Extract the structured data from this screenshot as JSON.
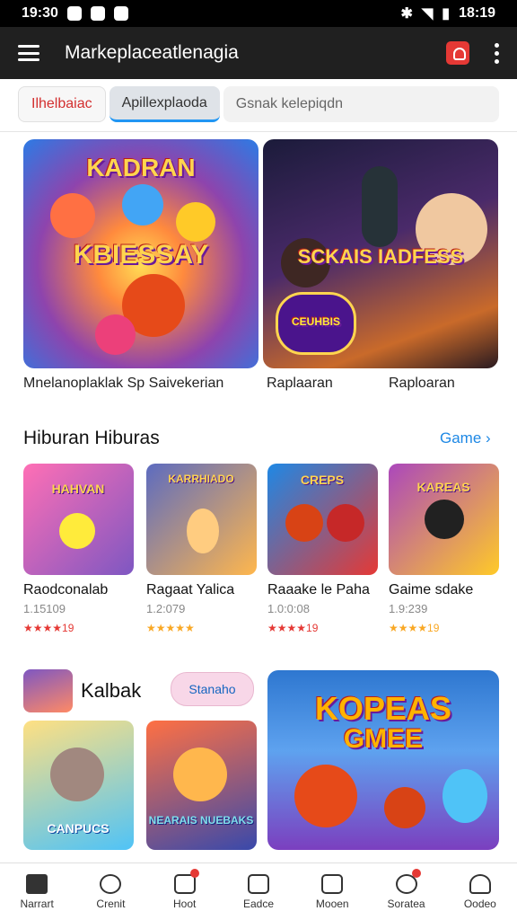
{
  "status_bar": {
    "time": "19:30",
    "right_text": "18:19"
  },
  "app_bar": {
    "title": "Markeplaceatlenagia"
  },
  "tabs": [
    {
      "label": "Ilhelbaiac"
    },
    {
      "label": "Apillexplaoda"
    },
    {
      "label": "Gsnak kelepiqdn"
    }
  ],
  "hero": {
    "left": {
      "title": "KADRAN",
      "subtitle": "KBIESSAY",
      "caption": "Mnelanoplaklak Sp Saivekerian"
    },
    "right": {
      "title": "SCKAIS IADFESS",
      "badge_text": "CEUHBIS",
      "caption_1": "Raplaaran",
      "caption_2": "Raploaran"
    }
  },
  "section": {
    "title": "Hiburan Hiburas",
    "link": "Game"
  },
  "apps": [
    {
      "name": "Raodconalab",
      "size": "1.15109",
      "rating": "★★★★19",
      "art_text": "HAHVAN",
      "colors": [
        "#ff6fb5",
        "#7e57c2"
      ]
    },
    {
      "name": "Ragaat Yalica",
      "size": "1.2:079",
      "rating": "★★★★★",
      "art_text": "KARRHIADO",
      "colors": [
        "#5c6bc0",
        "#ffb74d"
      ]
    },
    {
      "name": "Raaake le Paha",
      "size": "1.0:0:08",
      "rating": "★★★★19",
      "art_text": "CREPS",
      "colors": [
        "#1e88e5",
        "#e53935"
      ]
    },
    {
      "name": "Gaime sdake",
      "size": "1.9:239",
      "rating": "★★★★19",
      "art_text": "KAREAS",
      "colors": [
        "#ab47bc",
        "#ffca28"
      ]
    }
  ],
  "promo": {
    "title": "Kalbak",
    "chip": "Stanaho",
    "big_title": "KOPEAS",
    "big_subtitle": "GMEE",
    "small_1": "CANPUCS",
    "small_2": "NEARAIS NUEBAKS"
  },
  "bottom_nav": [
    {
      "label": "Narrart",
      "icon": "home-icon"
    },
    {
      "label": "Crenit",
      "icon": "people-icon"
    },
    {
      "label": "Hoot",
      "icon": "heart-icon",
      "badge": true
    },
    {
      "label": "Eadce",
      "icon": "tool-icon"
    },
    {
      "label": "Mooen",
      "icon": "frame-icon"
    },
    {
      "label": "Soratea",
      "icon": "refresh-icon",
      "badge": true
    },
    {
      "label": "Oodeo",
      "icon": "person-icon"
    }
  ]
}
